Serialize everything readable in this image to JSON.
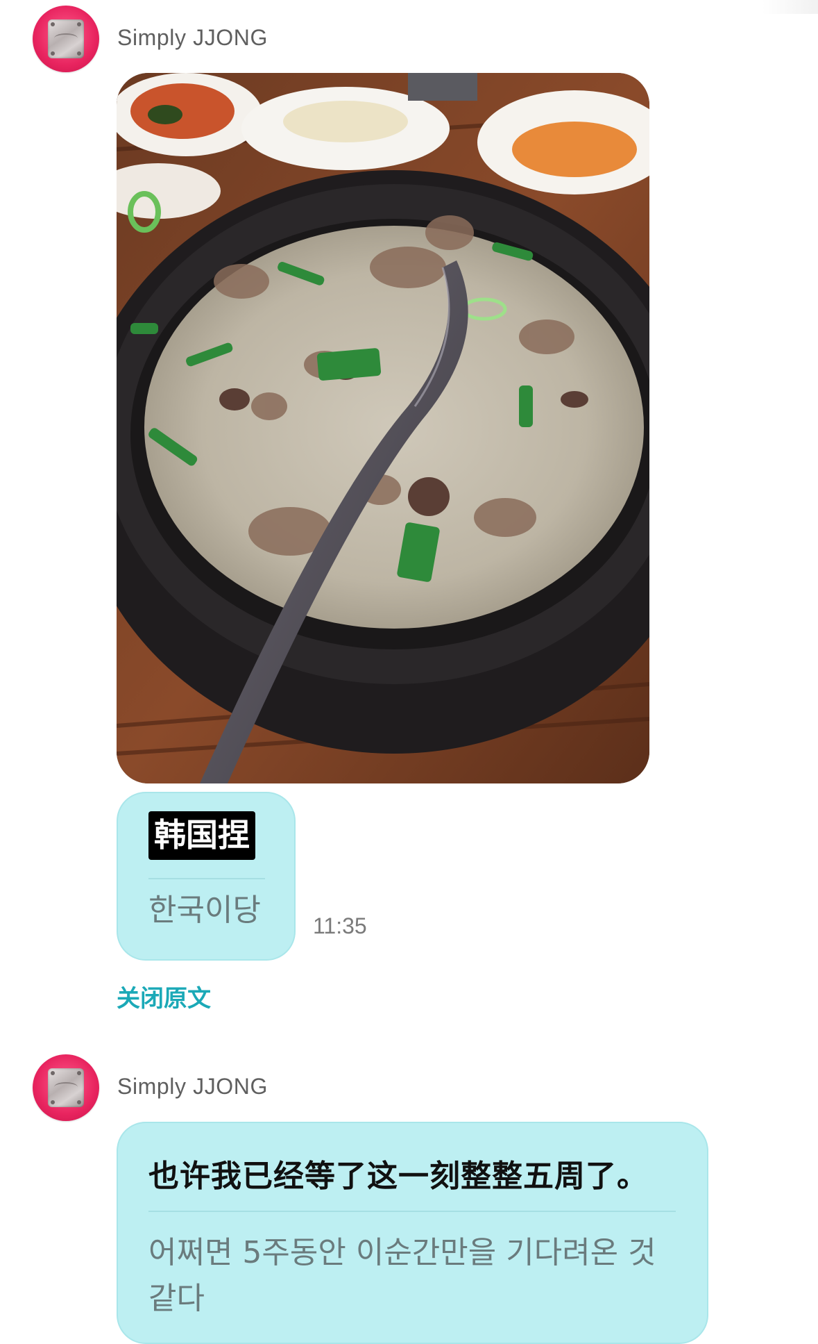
{
  "messages": [
    {
      "sender": "Simply JJONG",
      "photo_icon": "food-photo",
      "original_text": "韩国捏",
      "translated_text": "한국이당",
      "time": "11:35",
      "toggle_label": "关闭原文"
    },
    {
      "sender": "Simply JJONG",
      "original_text": "也许我已经等了这一刻整整五周了。",
      "translated_text": "어쩌면 5주동안 이순간만을 기다려온 것 같다"
    }
  ],
  "colors": {
    "bubble": "#bdeff2",
    "link": "#1ba9b7",
    "avatar": "#e8245f"
  }
}
